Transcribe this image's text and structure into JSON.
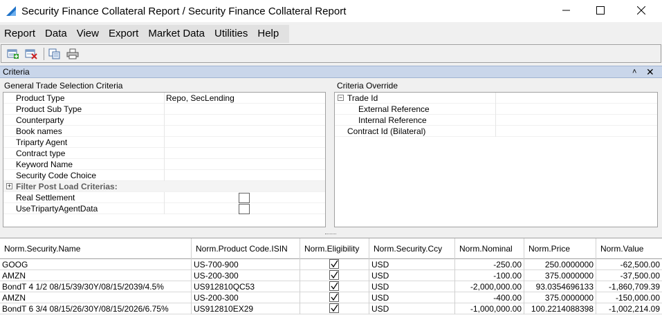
{
  "window": {
    "title": "Security Finance Collateral Report / Security Finance Collateral Report"
  },
  "menu": [
    "Report",
    "Data",
    "View",
    "Export",
    "Market Data",
    "Utilities",
    "Help"
  ],
  "criteria": {
    "title": "Criteria",
    "general": {
      "label": "General Trade Selection Criteria",
      "rows": [
        {
          "label": "Product Type",
          "value": "Repo, SecLending"
        },
        {
          "label": "Product Sub Type",
          "value": ""
        },
        {
          "label": "Counterparty",
          "value": ""
        },
        {
          "label": "Book names",
          "value": ""
        },
        {
          "label": "Triparty Agent",
          "value": ""
        },
        {
          "label": "Contract type",
          "value": ""
        },
        {
          "label": "Keyword Name",
          "value": ""
        },
        {
          "label": "Security Code Choice",
          "value": ""
        }
      ],
      "filter_label": "Filter Post Load Criterias:",
      "checks": [
        {
          "label": "Real Settlement",
          "checked": false
        },
        {
          "label": "UseTripartyAgentData",
          "checked": false
        }
      ]
    },
    "override": {
      "label": "Criteria Override",
      "trade_id": "Trade Id",
      "external": "External Reference",
      "internal": "Internal Reference",
      "contract": "Contract Id (Bilateral)"
    }
  },
  "table": {
    "columns": [
      "Norm.Security.Name",
      "Norm.Product Code.ISIN",
      "Norm.Eligibility",
      "Norm.Security.Ccy",
      "Norm.Nominal",
      "Norm.Price",
      "Norm.Value"
    ],
    "rows": [
      {
        "name": "GOOG",
        "isin": "US-700-900",
        "eligible": true,
        "ccy": "USD",
        "nominal": "-250.00",
        "price": "250.0000000",
        "value": "-62,500.00"
      },
      {
        "name": "AMZN",
        "isin": "US-200-300",
        "eligible": true,
        "ccy": "USD",
        "nominal": "-100.00",
        "price": "375.0000000",
        "value": "-37,500.00"
      },
      {
        "name": "BondT 4 1/2 08/15/39/30Y/08/15/2039/4.5%",
        "isin": "US912810QC53",
        "eligible": true,
        "ccy": "USD",
        "nominal": "-2,000,000.00",
        "price": "93.0354696133",
        "value": "-1,860,709.39"
      },
      {
        "name": "AMZN",
        "isin": "US-200-300",
        "eligible": true,
        "ccy": "USD",
        "nominal": "-400.00",
        "price": "375.0000000",
        "value": "-150,000.00"
      },
      {
        "name": "BondT 6 3/4 08/15/26/30Y/08/15/2026/6.75%",
        "isin": "US912810EX29",
        "eligible": true,
        "ccy": "USD",
        "nominal": "-1,000,000.00",
        "price": "100.2214088398",
        "value": "-1,002,214.09"
      }
    ]
  },
  "colors": {
    "criteria_header": "#c9d6ea",
    "icon_blue": "#1e72c8"
  }
}
